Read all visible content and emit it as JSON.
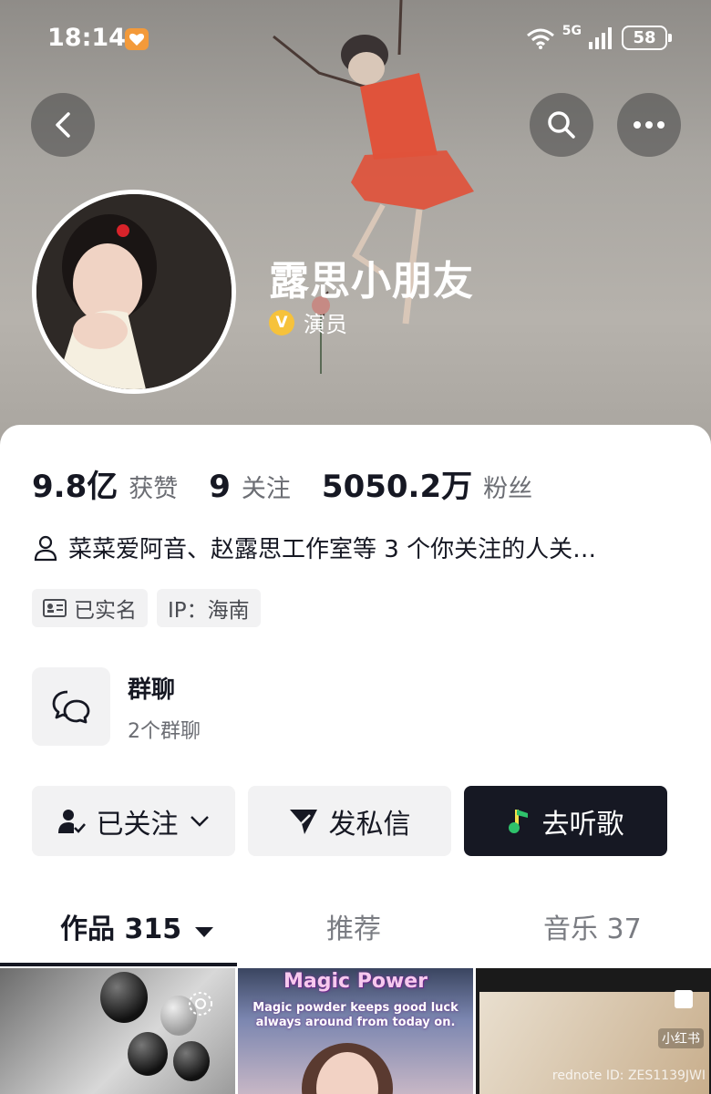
{
  "status_bar": {
    "time": "18:14",
    "network": "5G",
    "battery": "58"
  },
  "profile": {
    "nickname": "露思小朋友",
    "verify_badge": "V",
    "verified_label": "演员"
  },
  "stats": [
    {
      "num": "9.8亿",
      "label": "获赞"
    },
    {
      "num": "9",
      "label": "关注"
    },
    {
      "num": "5050.2万",
      "label": "粉丝"
    }
  ],
  "mutual_text": "菜菜爱阿音、赵露思工作室等 3 个你关注的人关…",
  "tags": [
    {
      "icon": "id-card-icon",
      "label": "已实名"
    },
    {
      "icon": "",
      "label": "IP：海南"
    }
  ],
  "group_chat": {
    "title": "群聊",
    "subtitle": "2个群聊"
  },
  "actions": {
    "follow": "已关注",
    "message": "发私信",
    "music": "去听歌"
  },
  "tabs": [
    {
      "label": "作品 315",
      "active": true
    },
    {
      "label": "推荐",
      "active": false
    },
    {
      "label": "音乐 37",
      "active": false
    }
  ],
  "thumbs": {
    "second_title": "Magic Power",
    "second_subtitle": "Magic powder keeps good luck always around from today on.",
    "third_badge": "小红书",
    "watermark": "rednote ID: ZES1139JWI"
  },
  "colors": {
    "primary_text": "#161823",
    "secondary_text": "#6b6d73",
    "button_bg": "#f2f2f3",
    "dark_button": "#161823",
    "verify_gold": "#f6c23b"
  }
}
